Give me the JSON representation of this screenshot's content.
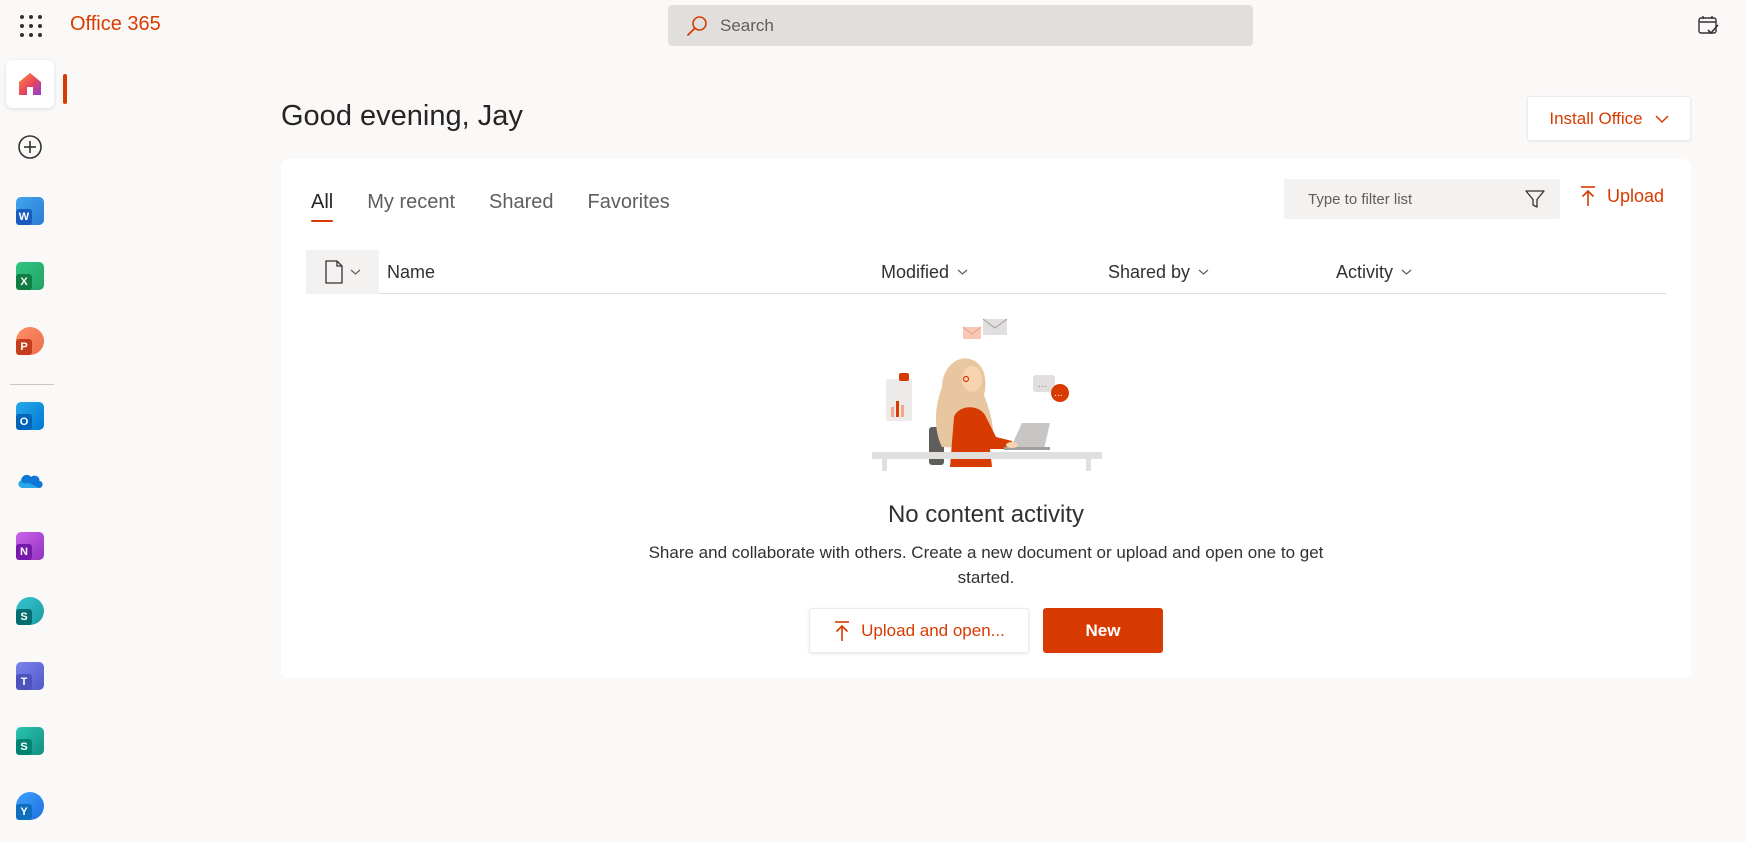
{
  "header": {
    "app_name": "Office 365",
    "search_placeholder": "Search",
    "waffle_icon": "app-launcher-icon",
    "top_right_icon": "calendar-check-icon"
  },
  "rail": {
    "items": [
      {
        "name": "home",
        "icon": "home-icon",
        "active": true
      },
      {
        "name": "create",
        "icon": "add-circle-icon"
      },
      {
        "name": "word",
        "icon": "word-icon",
        "letter": "W",
        "color": "#185abd"
      },
      {
        "name": "excel",
        "icon": "excel-icon",
        "letter": "X",
        "color": "#107c41"
      },
      {
        "name": "powerpoint",
        "icon": "powerpoint-icon",
        "letter": "P",
        "color": "#c43e1c"
      },
      {
        "name": "outlook",
        "icon": "outlook-icon",
        "letter": "O",
        "color": "#0364b8"
      },
      {
        "name": "onedrive",
        "icon": "onedrive-icon"
      },
      {
        "name": "onenote",
        "icon": "onenote-icon",
        "letter": "N",
        "color": "#7719aa"
      },
      {
        "name": "sharepoint",
        "icon": "sharepoint-icon",
        "letter": "S",
        "color": "#036c70"
      },
      {
        "name": "teams",
        "icon": "teams-icon",
        "letter": "T",
        "color": "#4b53bc"
      },
      {
        "name": "sway",
        "icon": "sway-icon",
        "letter": "S",
        "color": "#008272"
      },
      {
        "name": "yammer",
        "icon": "yammer-icon",
        "letter": "Y",
        "color": "#106ebe"
      }
    ]
  },
  "main": {
    "greeting": "Good evening, Jay",
    "install_label": "Install Office",
    "tabs": [
      {
        "label": "All",
        "active": true
      },
      {
        "label": "My recent"
      },
      {
        "label": "Shared"
      },
      {
        "label": "Favorites"
      }
    ],
    "filter_placeholder": "Type to filter list",
    "upload_label": "Upload",
    "columns": {
      "name": "Name",
      "modified": "Modified",
      "shared_by": "Shared by",
      "activity": "Activity"
    },
    "empty": {
      "title": "No content activity",
      "description": "Share and collaborate with others. Create a new document or upload and open one to get started.",
      "upload_open_label": "Upload and open...",
      "new_label": "New"
    }
  },
  "colors": {
    "accent": "#d83b01",
    "background": "#faf9f8"
  }
}
